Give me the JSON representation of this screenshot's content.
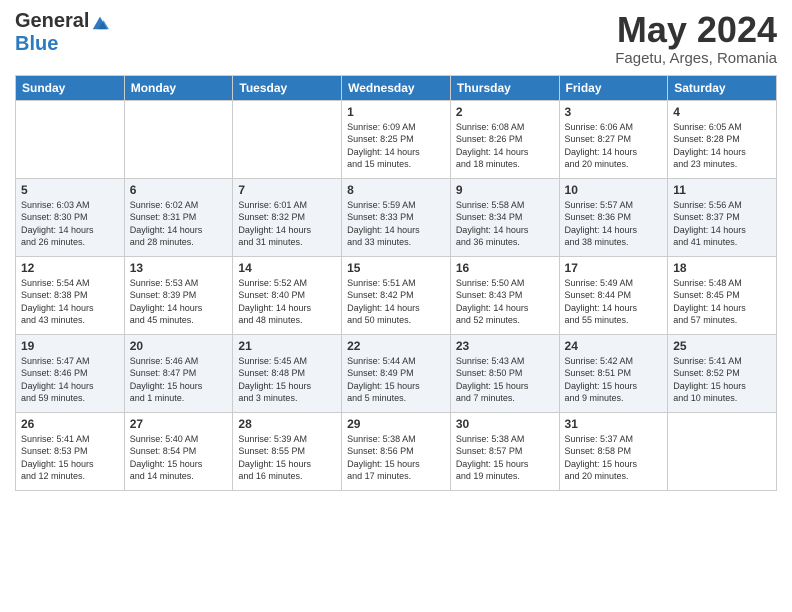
{
  "logo": {
    "general": "General",
    "blue": "Blue"
  },
  "header": {
    "month": "May 2024",
    "location": "Fagetu, Arges, Romania"
  },
  "weekdays": [
    "Sunday",
    "Monday",
    "Tuesday",
    "Wednesday",
    "Thursday",
    "Friday",
    "Saturday"
  ],
  "weeks": [
    [
      {
        "day": "",
        "info": ""
      },
      {
        "day": "",
        "info": ""
      },
      {
        "day": "",
        "info": ""
      },
      {
        "day": "1",
        "info": "Sunrise: 6:09 AM\nSunset: 8:25 PM\nDaylight: 14 hours\nand 15 minutes."
      },
      {
        "day": "2",
        "info": "Sunrise: 6:08 AM\nSunset: 8:26 PM\nDaylight: 14 hours\nand 18 minutes."
      },
      {
        "day": "3",
        "info": "Sunrise: 6:06 AM\nSunset: 8:27 PM\nDaylight: 14 hours\nand 20 minutes."
      },
      {
        "day": "4",
        "info": "Sunrise: 6:05 AM\nSunset: 8:28 PM\nDaylight: 14 hours\nand 23 minutes."
      }
    ],
    [
      {
        "day": "5",
        "info": "Sunrise: 6:03 AM\nSunset: 8:30 PM\nDaylight: 14 hours\nand 26 minutes."
      },
      {
        "day": "6",
        "info": "Sunrise: 6:02 AM\nSunset: 8:31 PM\nDaylight: 14 hours\nand 28 minutes."
      },
      {
        "day": "7",
        "info": "Sunrise: 6:01 AM\nSunset: 8:32 PM\nDaylight: 14 hours\nand 31 minutes."
      },
      {
        "day": "8",
        "info": "Sunrise: 5:59 AM\nSunset: 8:33 PM\nDaylight: 14 hours\nand 33 minutes."
      },
      {
        "day": "9",
        "info": "Sunrise: 5:58 AM\nSunset: 8:34 PM\nDaylight: 14 hours\nand 36 minutes."
      },
      {
        "day": "10",
        "info": "Sunrise: 5:57 AM\nSunset: 8:36 PM\nDaylight: 14 hours\nand 38 minutes."
      },
      {
        "day": "11",
        "info": "Sunrise: 5:56 AM\nSunset: 8:37 PM\nDaylight: 14 hours\nand 41 minutes."
      }
    ],
    [
      {
        "day": "12",
        "info": "Sunrise: 5:54 AM\nSunset: 8:38 PM\nDaylight: 14 hours\nand 43 minutes."
      },
      {
        "day": "13",
        "info": "Sunrise: 5:53 AM\nSunset: 8:39 PM\nDaylight: 14 hours\nand 45 minutes."
      },
      {
        "day": "14",
        "info": "Sunrise: 5:52 AM\nSunset: 8:40 PM\nDaylight: 14 hours\nand 48 minutes."
      },
      {
        "day": "15",
        "info": "Sunrise: 5:51 AM\nSunset: 8:42 PM\nDaylight: 14 hours\nand 50 minutes."
      },
      {
        "day": "16",
        "info": "Sunrise: 5:50 AM\nSunset: 8:43 PM\nDaylight: 14 hours\nand 52 minutes."
      },
      {
        "day": "17",
        "info": "Sunrise: 5:49 AM\nSunset: 8:44 PM\nDaylight: 14 hours\nand 55 minutes."
      },
      {
        "day": "18",
        "info": "Sunrise: 5:48 AM\nSunset: 8:45 PM\nDaylight: 14 hours\nand 57 minutes."
      }
    ],
    [
      {
        "day": "19",
        "info": "Sunrise: 5:47 AM\nSunset: 8:46 PM\nDaylight: 14 hours\nand 59 minutes."
      },
      {
        "day": "20",
        "info": "Sunrise: 5:46 AM\nSunset: 8:47 PM\nDaylight: 15 hours\nand 1 minute."
      },
      {
        "day": "21",
        "info": "Sunrise: 5:45 AM\nSunset: 8:48 PM\nDaylight: 15 hours\nand 3 minutes."
      },
      {
        "day": "22",
        "info": "Sunrise: 5:44 AM\nSunset: 8:49 PM\nDaylight: 15 hours\nand 5 minutes."
      },
      {
        "day": "23",
        "info": "Sunrise: 5:43 AM\nSunset: 8:50 PM\nDaylight: 15 hours\nand 7 minutes."
      },
      {
        "day": "24",
        "info": "Sunrise: 5:42 AM\nSunset: 8:51 PM\nDaylight: 15 hours\nand 9 minutes."
      },
      {
        "day": "25",
        "info": "Sunrise: 5:41 AM\nSunset: 8:52 PM\nDaylight: 15 hours\nand 10 minutes."
      }
    ],
    [
      {
        "day": "26",
        "info": "Sunrise: 5:41 AM\nSunset: 8:53 PM\nDaylight: 15 hours\nand 12 minutes."
      },
      {
        "day": "27",
        "info": "Sunrise: 5:40 AM\nSunset: 8:54 PM\nDaylight: 15 hours\nand 14 minutes."
      },
      {
        "day": "28",
        "info": "Sunrise: 5:39 AM\nSunset: 8:55 PM\nDaylight: 15 hours\nand 16 minutes."
      },
      {
        "day": "29",
        "info": "Sunrise: 5:38 AM\nSunset: 8:56 PM\nDaylight: 15 hours\nand 17 minutes."
      },
      {
        "day": "30",
        "info": "Sunrise: 5:38 AM\nSunset: 8:57 PM\nDaylight: 15 hours\nand 19 minutes."
      },
      {
        "day": "31",
        "info": "Sunrise: 5:37 AM\nSunset: 8:58 PM\nDaylight: 15 hours\nand 20 minutes."
      },
      {
        "day": "",
        "info": ""
      }
    ]
  ]
}
